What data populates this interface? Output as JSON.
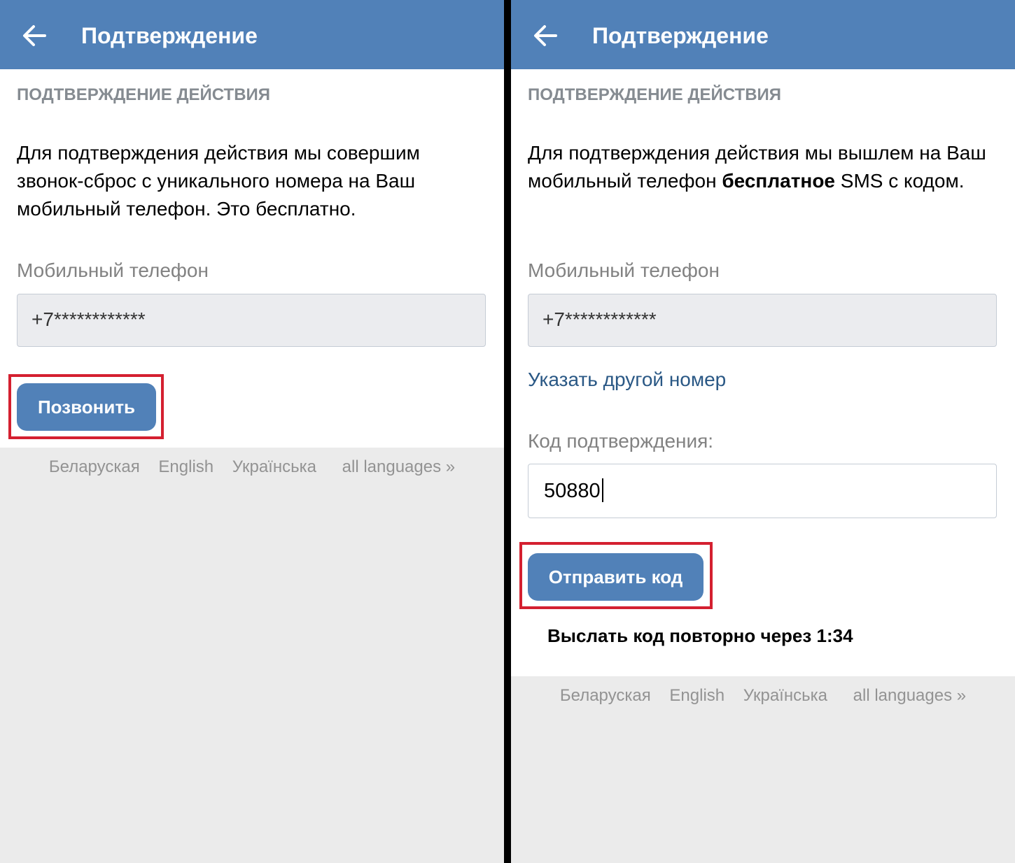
{
  "left_screen": {
    "header": {
      "title": "Подтверждение",
      "back_icon": "arrow-left-icon"
    },
    "section_caption": "ПОДТВЕРЖДЕНИЕ ДЕЙСТВИЯ",
    "description": "Для подтверждения действия мы совершим звонок-сброс с уникального номера на Ваш мобильный телефон. Это бесплатно.",
    "phone_label": "Мобильный телефон",
    "phone_value": "+7************",
    "call_button": "Позвонить",
    "footer_langs": [
      "Беларуская",
      "English",
      "Українська",
      "all languages »"
    ]
  },
  "right_screen": {
    "header": {
      "title": "Подтверждение",
      "back_icon": "arrow-left-icon"
    },
    "section_caption": "ПОДТВЕРЖДЕНИЕ ДЕЙСТВИЯ",
    "description_before": "Для подтверждения действия мы вышлем на Ваш мобильный телефон ",
    "description_bold": "бесплатное",
    "description_after": " SMS с кодом.",
    "phone_label": "Мобильный телефон",
    "phone_value": "+7************",
    "change_number_link": "Указать другой номер",
    "code_label": "Код подтверждения:",
    "code_value": "50880",
    "send_button": "Отправить код",
    "resend_text": "Выслать код повторно через 1:34",
    "footer_langs": [
      "Беларуская",
      "English",
      "Українська",
      "all languages »"
    ]
  },
  "colors": {
    "header": "#5181b8",
    "button": "#5181b8",
    "link": "#2a5885",
    "highlight": "#d42030",
    "footer_bg": "#ebebeb",
    "divider": "#000000"
  }
}
